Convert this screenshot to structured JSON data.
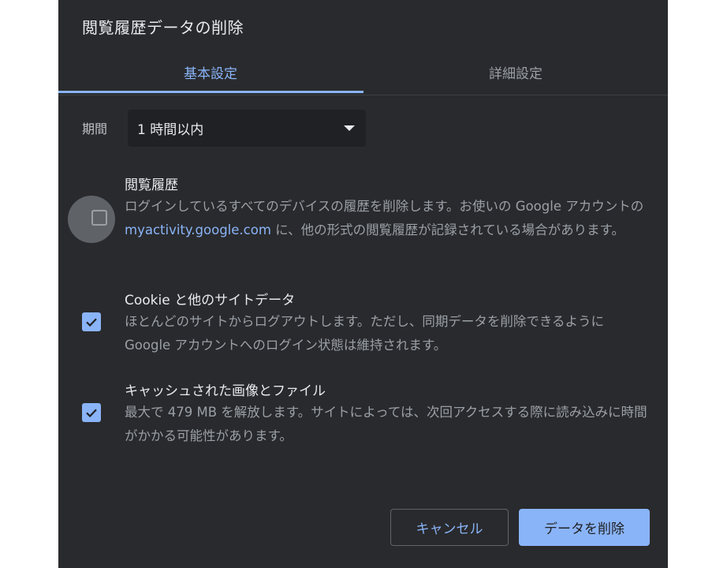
{
  "dialog": {
    "title": "閲覧履歴データの削除",
    "tabs": [
      {
        "label": "基本設定",
        "active": true
      },
      {
        "label": "詳細設定",
        "active": false
      }
    ],
    "period": {
      "label": "期間",
      "value": "1 時間以内"
    },
    "options": [
      {
        "title": "閲覧履歴",
        "checked": false,
        "desc_before_link": "ログインしているすべてのデバイスの履歴を削除します。お使いの Google アカウントの ",
        "link": "myactivity.google.com",
        "desc_after_link": " に、他の形式の閲覧履歴が記録されている場合があります。"
      },
      {
        "title": "Cookie と他のサイトデータ",
        "checked": true,
        "desc": "ほとんどのサイトからログアウトします。ただし、同期データを削除できるように Google アカウントへのログイン状態は維持されます。"
      },
      {
        "title": "キャッシュされた画像とファイル",
        "checked": true,
        "desc": "最大で 479 MB を解放します。サイトによっては、次回アクセスする際に読み込みに時間がかかる可能性があります。"
      }
    ],
    "buttons": {
      "cancel": "キャンセル",
      "delete": "データを削除"
    }
  },
  "colors": {
    "background": "#292a2d",
    "accent": "#8ab4f8",
    "text_primary": "#e8eaed",
    "text_secondary": "#9aa0a6",
    "select_bg": "#202124"
  },
  "icons": {
    "dropdown": "caret-down-icon",
    "checkbox_checked": "checkmark-icon"
  }
}
